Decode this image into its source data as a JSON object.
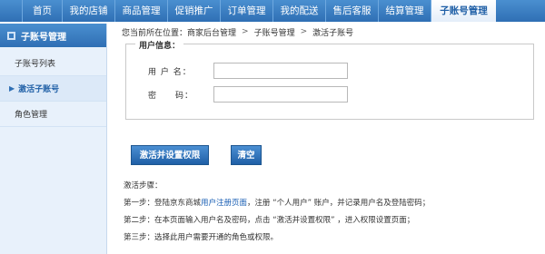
{
  "nav": {
    "items": [
      {
        "label": "首页"
      },
      {
        "label": "我的店铺"
      },
      {
        "label": "商品管理"
      },
      {
        "label": "促销推广"
      },
      {
        "label": "订单管理"
      },
      {
        "label": "我的配送"
      },
      {
        "label": "售后客服"
      },
      {
        "label": "结算管理"
      },
      {
        "label": "子账号管理"
      }
    ],
    "active_index": 8
  },
  "sidebar": {
    "title": "子账号管理",
    "items": [
      {
        "label": "子账号列表"
      },
      {
        "label": "激活子账号"
      },
      {
        "label": "角色管理"
      }
    ],
    "active_index": 1
  },
  "breadcrumb": {
    "prefix": "您当前所在位置：",
    "items": [
      "商家后台管理",
      "子账号管理",
      "激活子账号"
    ],
    "separator": ">"
  },
  "form": {
    "legend": "用户信息：",
    "username_label": "用 户 名：",
    "username_value": "",
    "password_label": "密　　码：",
    "password_value": ""
  },
  "buttons": {
    "activate": "激活并设置权限",
    "clear": "清空"
  },
  "steps": {
    "title": "激活步骤：",
    "step1_prefix": "第一步：登陆京东商城",
    "step1_link": "用户注册页面",
    "step1_suffix": "，注册 “个人用户” 账户，并记录用户名及登陆密码；",
    "step2": "第二步：在本页面输入用户名及密码，点击 “激活并设置权限” ，进入权限设置页面；",
    "step3": "第三步：选择此用户需要开通的角色或权限。"
  },
  "colors": {
    "nav_gradient_top": "#4a8fd0",
    "nav_gradient_bottom": "#2f6fb4",
    "sidebar_bg": "#e8f1fb",
    "link": "#1a5fb4"
  }
}
